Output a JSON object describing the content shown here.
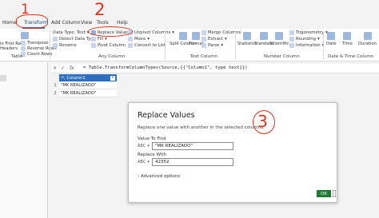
{
  "tabs": [
    "Home",
    "Transform",
    "Add Column",
    "View",
    "Tools",
    "Help"
  ],
  "ribbon": {
    "left_items": [
      "le First Row",
      "Headers"
    ],
    "table_items": [
      "Transpose",
      "Reverse Rows",
      "Count Rows"
    ],
    "any_items": [
      "Data Type: Text",
      "Detect Data Type",
      "Rename",
      "Replace Values",
      "Fill",
      "Pivot Column"
    ],
    "any_items2": [
      "Unpivot Columns",
      "Move",
      "Convert to List"
    ],
    "text_items": [
      "Split Column",
      "Format",
      "Merge Columns",
      "Extract",
      "Parse"
    ],
    "number_items": [
      "Statistics",
      "Standard",
      "Scientific",
      "Trigonometry",
      "Rounding",
      "Information"
    ],
    "date_items": [
      "Date",
      "Time",
      "Duration"
    ],
    "groups": [
      "Table",
      "Any Column",
      "Text Column",
      "Number Column",
      "Date & Time Column"
    ]
  },
  "formula": {
    "fx": "fx",
    "text": "= Table.TransformColumnTypes(Source,{{\"Column1\", type text}})"
  },
  "grid": {
    "header": "Column1",
    "rows": [
      {
        "num": "1",
        "value": "\"MK REALIZADO\""
      },
      {
        "num": "2",
        "value": "\"MK REALIZADO\""
      }
    ]
  },
  "dialog": {
    "title": "Replace Values",
    "desc": "Replace one value with another in the selected columns.",
    "find_label": "Value To Find",
    "find_type": "ABC",
    "find_value": "\"MK REALIZADO\"",
    "replace_label": "Replace With",
    "replace_type": "ABC",
    "replace_value": "42352",
    "advanced": "Advanced options",
    "ok": "OK"
  },
  "annotations": [
    "1",
    "2",
    "3"
  ],
  "colors": {
    "accent": "#2e6fbf",
    "ok": "#1e7b34",
    "annotation": "#e0321c"
  }
}
